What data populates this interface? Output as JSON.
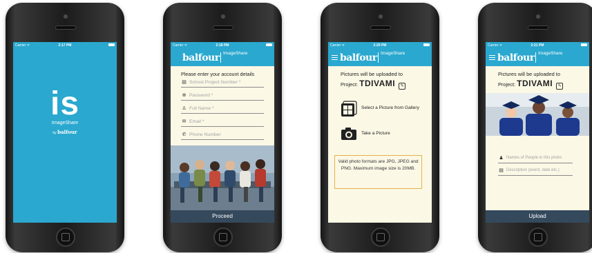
{
  "status": {
    "carrier": "Carrier ᯤ"
  },
  "brand": {
    "name": "balfour",
    "product": "ImageShare"
  },
  "splash": {
    "logo": "is",
    "app_name": "ImageShare",
    "by": "by",
    "by_brand": "balfour",
    "time": "2:17 PM"
  },
  "login": {
    "time": "2:18 PM",
    "title": "Please enter your account details",
    "fields": [
      {
        "placeholder": "School Project Number *",
        "icon": "document-icon"
      },
      {
        "placeholder": "Password *",
        "icon": "lock-icon"
      },
      {
        "placeholder": "Full Name *",
        "icon": "person-icon"
      },
      {
        "placeholder": "Email *",
        "icon": "mail-icon"
      },
      {
        "placeholder": "Phone Number",
        "icon": "phone-icon"
      }
    ],
    "proceed": "Proceed"
  },
  "upload_choice": {
    "time": "2:20 PM",
    "line1": "Pictures will be uploaded to",
    "project_label": "Project:",
    "project_value": "TDIVAMI",
    "gallery": "Select a Picture from Gallery",
    "camera": "Take a Picture",
    "info": "Valid photo formats are JPG, JPEG and PNG. Maximum image size is 20MB."
  },
  "upload_form": {
    "time": "2:21 PM",
    "line1": "Pictures will be uploaded to",
    "project_label": "Project:",
    "project_value": "TDIVAMI",
    "names_placeholder": "Names of People in this photo",
    "description_placeholder": "Description (event, date etc.)",
    "upload": "Upload"
  },
  "colors": {
    "header": "#2aa8cf",
    "bar": "#35495c",
    "background": "#fbf8e6",
    "info_border": "#e6b24a"
  }
}
